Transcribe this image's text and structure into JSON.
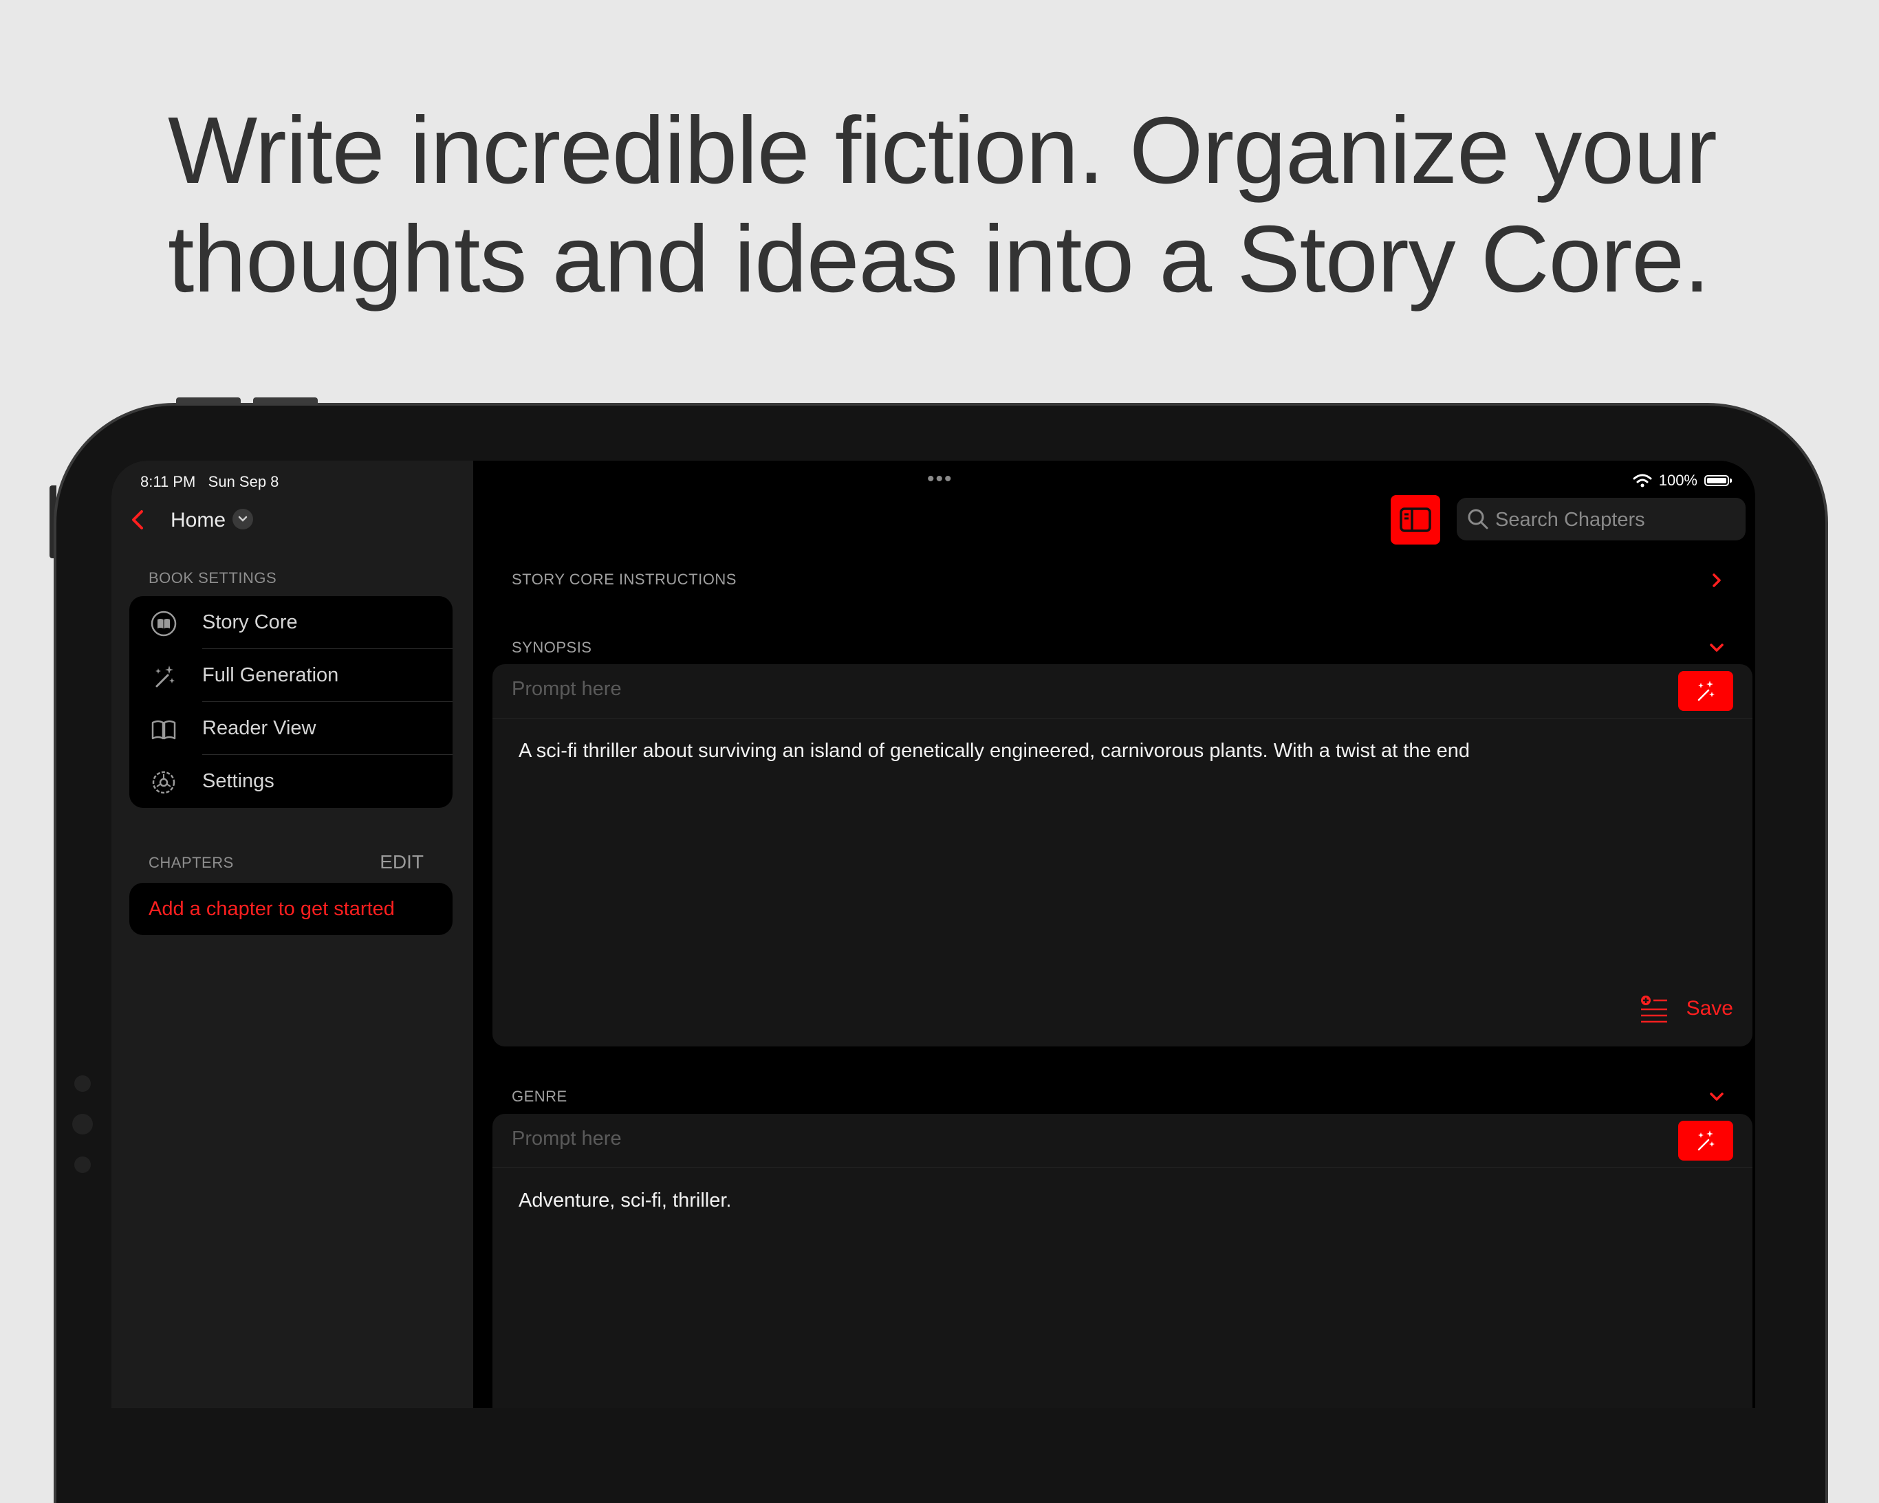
{
  "headline": {
    "line1": "Write incredible fiction. Organize your",
    "line2": "thoughts and ideas into a Story Core."
  },
  "status_bar": {
    "time": "8:11 PM",
    "date": "Sun Sep 8",
    "battery": "100%",
    "icons": [
      "wifi-icon",
      "battery-icon"
    ]
  },
  "sidebar": {
    "nav_title": "Home",
    "book_settings_label": "BOOK SETTINGS",
    "items": [
      {
        "label": "Story Core",
        "icon": "book-circle-icon"
      },
      {
        "label": "Full Generation",
        "icon": "magic-wand-icon"
      },
      {
        "label": "Reader View",
        "icon": "open-book-icon"
      },
      {
        "label": "Settings",
        "icon": "gear-icon"
      }
    ],
    "chapters_label": "CHAPTERS",
    "edit_label": "EDIT",
    "empty_chapter_text": "Add a chapter to get started"
  },
  "toolbar": {
    "search_placeholder": "Search Chapters"
  },
  "main": {
    "instructions_label": "STORY CORE INSTRUCTIONS",
    "synopsis": {
      "label": "SYNOPSIS",
      "prompt_placeholder": "Prompt here",
      "text": "A sci-fi thriller about surviving an island of genetically engineered, carnivorous plants. With a twist at the end",
      "save_label": "Save"
    },
    "genre": {
      "label": "GENRE",
      "prompt_placeholder": "Prompt here",
      "text": "Adventure, sci-fi, thriller."
    }
  },
  "colors": {
    "accent": "#ff0000",
    "background": "#e8e8e8",
    "screen": "#000000",
    "panel": "#161616"
  }
}
